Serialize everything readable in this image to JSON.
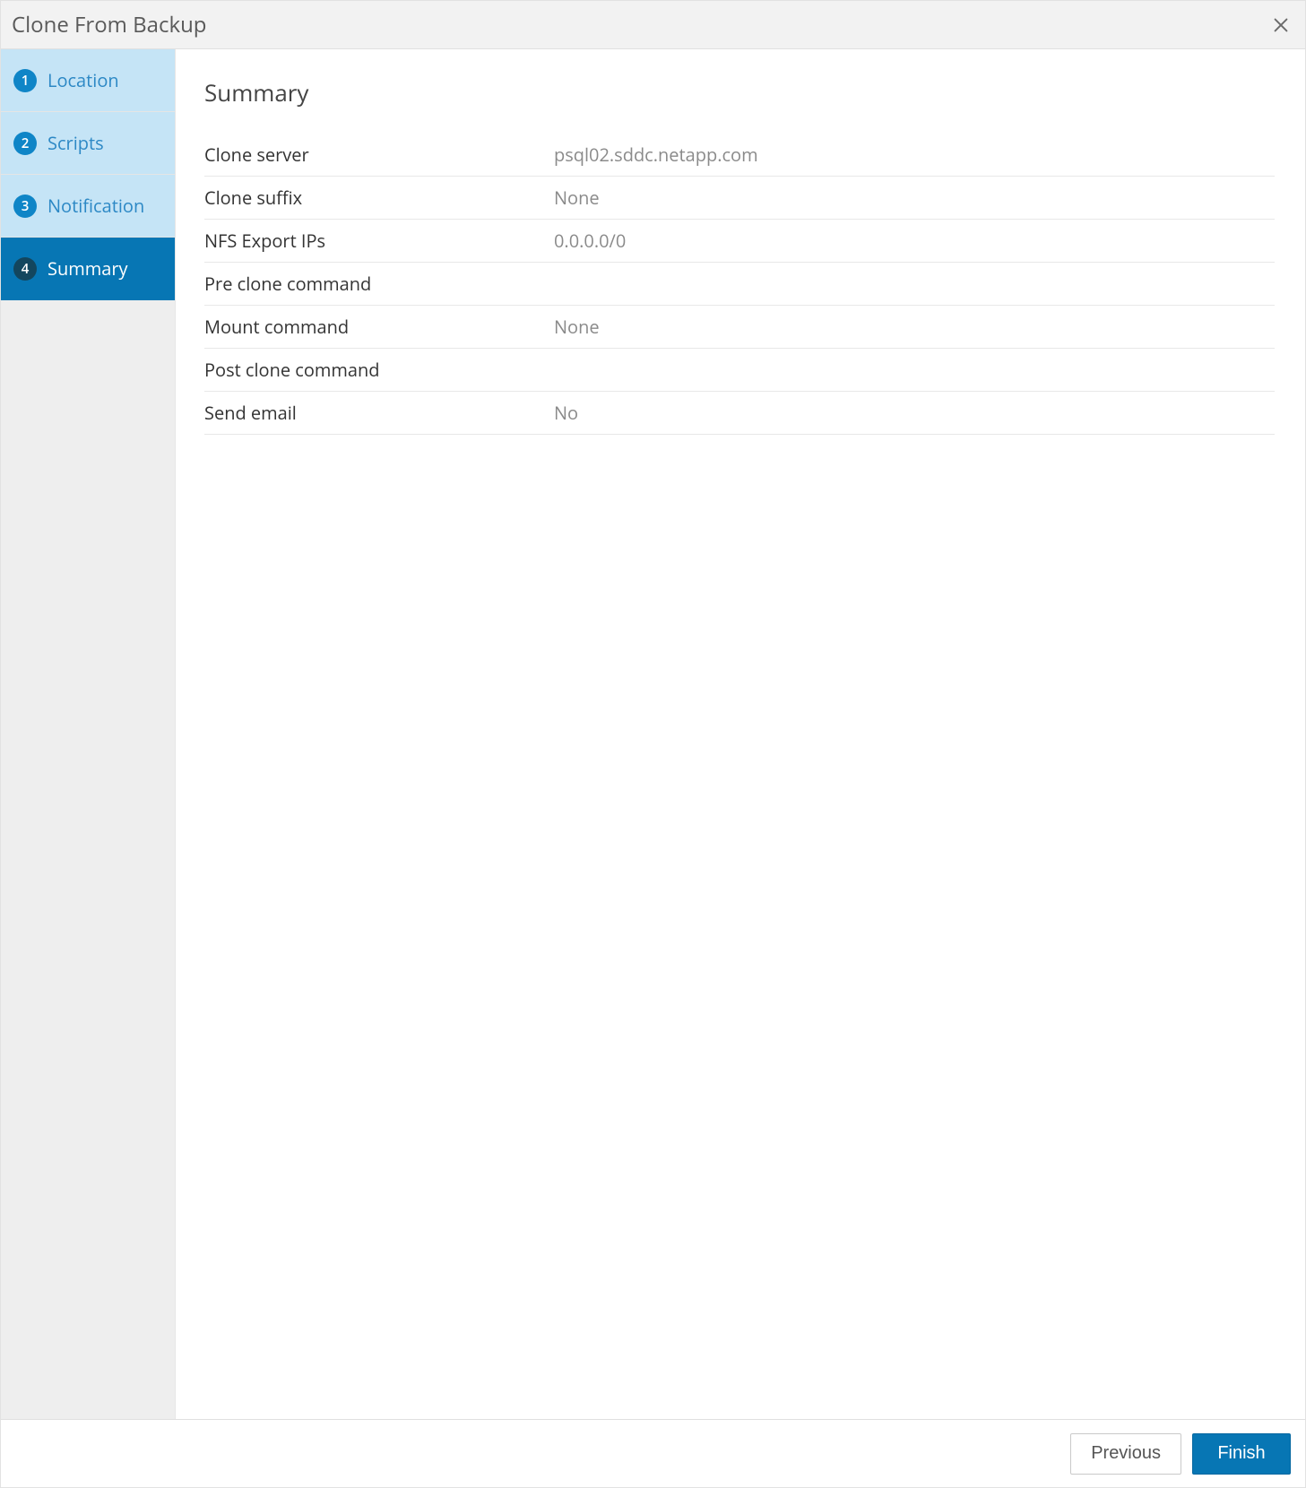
{
  "header": {
    "title": "Clone From Backup"
  },
  "sidebar": {
    "steps": [
      {
        "num": "1",
        "label": "Location"
      },
      {
        "num": "2",
        "label": "Scripts"
      },
      {
        "num": "3",
        "label": "Notification"
      },
      {
        "num": "4",
        "label": "Summary"
      }
    ]
  },
  "main": {
    "title": "Summary",
    "rows": [
      {
        "label": "Clone server",
        "value": "psql02.sddc.netapp.com"
      },
      {
        "label": "Clone suffix",
        "value": "None"
      },
      {
        "label": "NFS Export IPs",
        "value": "0.0.0.0/0"
      },
      {
        "label": "Pre clone command",
        "value": ""
      },
      {
        "label": "Mount command",
        "value": "None"
      },
      {
        "label": "Post clone command",
        "value": ""
      },
      {
        "label": "Send email",
        "value": "No"
      }
    ]
  },
  "footer": {
    "previous": "Previous",
    "finish": "Finish"
  }
}
